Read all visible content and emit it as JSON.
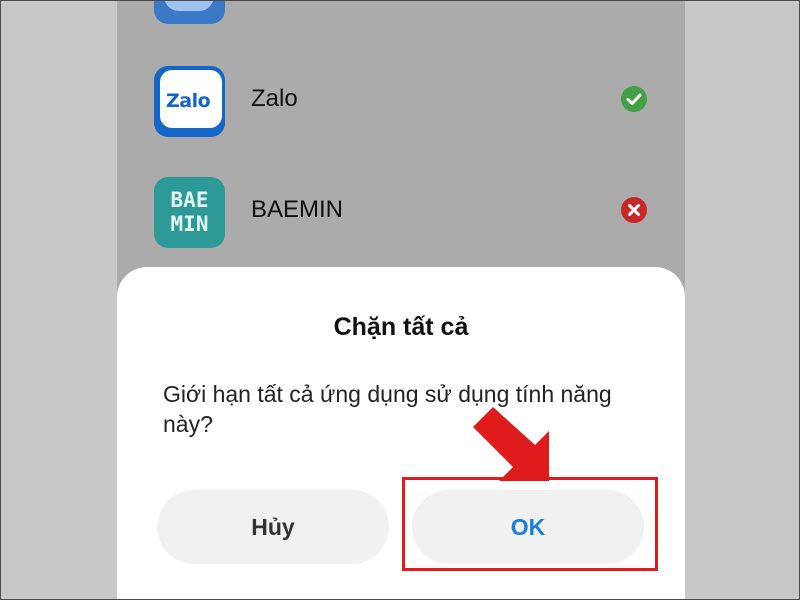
{
  "apps": [
    {
      "name": "Zalo",
      "icon": "zalo-app-icon",
      "icon_text": "Zalo",
      "status": "allowed",
      "status_icon": "check-circle-icon"
    },
    {
      "name": "BAEMIN",
      "icon": "baemin-app-icon",
      "icon_text": "BAE\nMIN",
      "status": "denied",
      "status_icon": "x-circle-icon"
    }
  ],
  "dialog": {
    "title": "Chặn tất cả",
    "message": "Giới hạn tất cả ứng dụng sử dụng tính năng này?",
    "cancel_label": "Hủy",
    "ok_label": "OK"
  },
  "colors": {
    "ok_text": "#1a7ee0",
    "allowed": "#43a047",
    "denied": "#c62828",
    "annotation": "#e01b1b"
  }
}
